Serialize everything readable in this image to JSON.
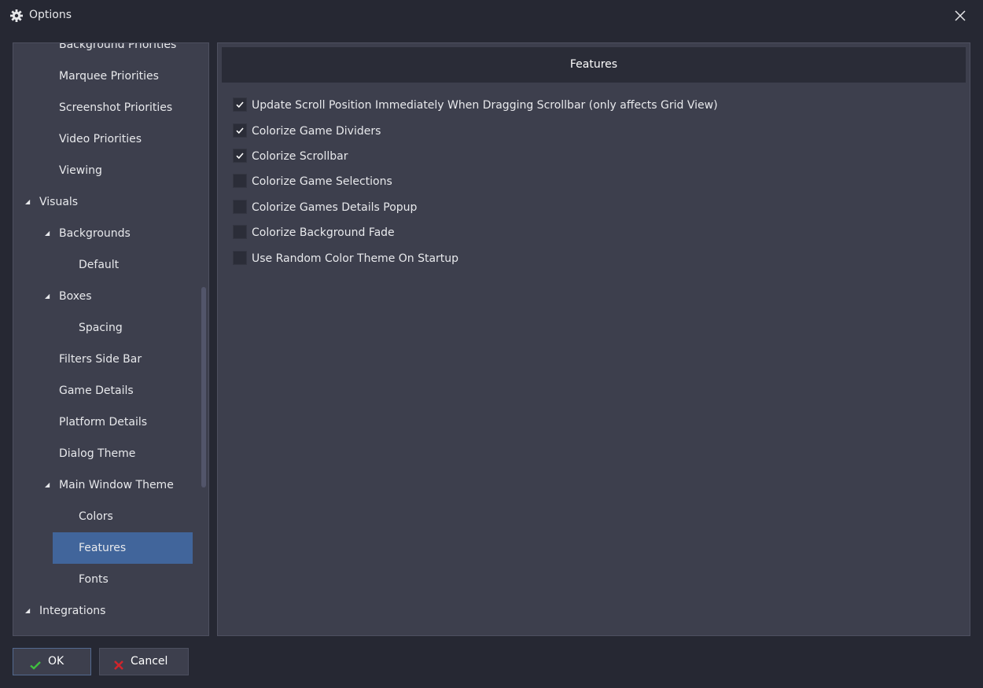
{
  "window": {
    "title": "Options",
    "title_icon": "gear-icon",
    "close_icon": "close-icon"
  },
  "tree": {
    "items": [
      {
        "label": "Background Priorities",
        "level": 1,
        "expanded": null,
        "selected": false
      },
      {
        "label": "Marquee Priorities",
        "level": 1,
        "expanded": null,
        "selected": false
      },
      {
        "label": "Screenshot Priorities",
        "level": 1,
        "expanded": null,
        "selected": false
      },
      {
        "label": "Video Priorities",
        "level": 1,
        "expanded": null,
        "selected": false
      },
      {
        "label": "Viewing",
        "level": 1,
        "expanded": null,
        "selected": false
      },
      {
        "label": "Visuals",
        "level": 0,
        "expanded": true,
        "selected": false
      },
      {
        "label": "Backgrounds",
        "level": 1,
        "expanded": true,
        "selected": false
      },
      {
        "label": "Default",
        "level": 2,
        "expanded": null,
        "selected": false
      },
      {
        "label": "Boxes",
        "level": 1,
        "expanded": true,
        "selected": false
      },
      {
        "label": "Spacing",
        "level": 2,
        "expanded": null,
        "selected": false
      },
      {
        "label": "Filters Side Bar",
        "level": 1,
        "expanded": null,
        "selected": false
      },
      {
        "label": "Game Details",
        "level": 1,
        "expanded": null,
        "selected": false
      },
      {
        "label": "Platform Details",
        "level": 1,
        "expanded": null,
        "selected": false
      },
      {
        "label": "Dialog Theme",
        "level": 1,
        "expanded": null,
        "selected": false
      },
      {
        "label": "Main Window Theme",
        "level": 1,
        "expanded": true,
        "selected": false
      },
      {
        "label": "Colors",
        "level": 2,
        "expanded": null,
        "selected": false
      },
      {
        "label": "Features",
        "level": 2,
        "expanded": null,
        "selected": true
      },
      {
        "label": "Fonts",
        "level": 2,
        "expanded": null,
        "selected": false
      },
      {
        "label": "Integrations",
        "level": 0,
        "expanded": true,
        "selected": false
      }
    ]
  },
  "content": {
    "header": "Features",
    "options": [
      {
        "label": "Update Scroll Position Immediately When Dragging Scrollbar (only affects Grid View)",
        "checked": true
      },
      {
        "label": "Colorize Game Dividers",
        "checked": true
      },
      {
        "label": "Colorize Scrollbar",
        "checked": true
      },
      {
        "label": "Colorize Game Selections",
        "checked": false
      },
      {
        "label": "Colorize Games Details Popup",
        "checked": false
      },
      {
        "label": "Colorize Background Fade",
        "checked": false
      },
      {
        "label": "Use Random Color Theme On Startup",
        "checked": false
      }
    ]
  },
  "buttons": {
    "ok": {
      "label": "OK",
      "icon": "checkmark-icon"
    },
    "cancel": {
      "label": "Cancel",
      "icon": "x-icon"
    }
  },
  "colors": {
    "background": "#262833",
    "panel": "#3d3f4d",
    "selection": "#41659b",
    "ok_icon": "#3fbf3f",
    "cancel_icon": "#d0252b"
  }
}
